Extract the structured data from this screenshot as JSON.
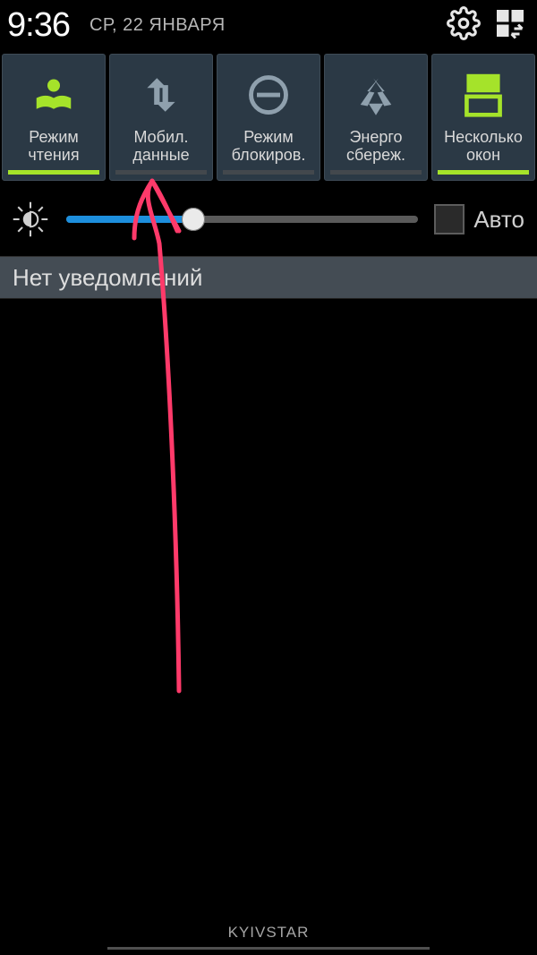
{
  "status": {
    "time": "9:36",
    "date": "СР, 22 ЯНВАРЯ"
  },
  "tiles": [
    {
      "label": "Режим\nчтения",
      "active": true
    },
    {
      "label": "Мобил.\nданные",
      "active": false
    },
    {
      "label": "Режим\nблокиров.",
      "active": false
    },
    {
      "label": "Энерго\nсбереж.",
      "active": false
    },
    {
      "label": "Несколько\nокон",
      "active": true
    }
  ],
  "brightness": {
    "percent": 36,
    "auto_label": "Авто",
    "auto_checked": false
  },
  "notifications": {
    "empty_text": "Нет уведомлений"
  },
  "footer": {
    "carrier": "KYIVSTAR"
  },
  "colors": {
    "accent": "#a5e32a",
    "tile_bg": "#2b3945",
    "slider_fill": "#1d8fdd",
    "annotation": "#ff3a6a"
  }
}
